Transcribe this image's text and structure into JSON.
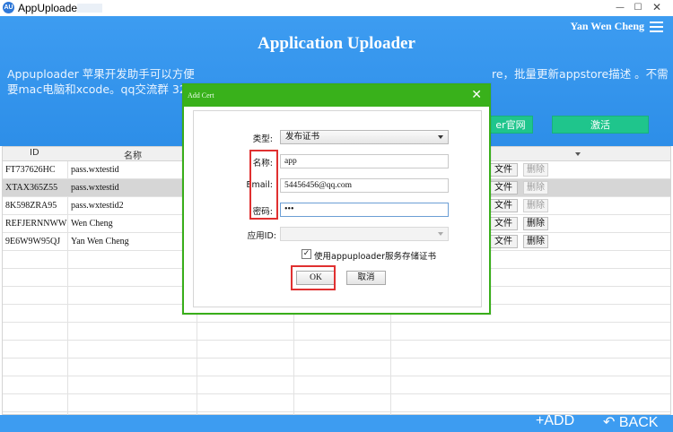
{
  "window": {
    "app_icon_text": "AU",
    "title": "AppUploader",
    "minimize_glyph": "—",
    "maximize_glyph": "☐",
    "close_glyph": "✕"
  },
  "header": {
    "user_name": "Yan Wen Cheng",
    "title": "Application Uploader",
    "desc_line1_a": "Appuploader 苹果开发助手可以方便",
    "desc_line1_b": "re，批量更新appstore描述 。不需",
    "desc_line2": "要mac电脑和xcode。qq交流群 326",
    "site_button": "er官网",
    "activate_button": "激活",
    "accent_color": "#3d9cf1",
    "button_color": "#1fc58c"
  },
  "table": {
    "columns": [
      "ID",
      "名称"
    ],
    "rows": [
      {
        "id": "FT737626HC",
        "name": "pass.wxtestid",
        "file": "文件",
        "delete": "删除",
        "delete_enabled": false,
        "selected": false
      },
      {
        "id": "XTAX365Z55",
        "name": "pass.wxtestid",
        "file": "文件",
        "delete": "删除",
        "delete_enabled": false,
        "selected": true
      },
      {
        "id": "8K598ZRA95",
        "name": "pass.wxtestid2",
        "file": "文件",
        "delete": "删除",
        "delete_enabled": false,
        "selected": false
      },
      {
        "id": "REFJERNNWW",
        "name": "Wen Cheng",
        "file": "文件",
        "delete": "删除",
        "delete_enabled": true,
        "selected": false
      },
      {
        "id": "9E6W9W95QJ",
        "name": "Yan Wen Cheng",
        "file": "文件",
        "delete": "删除",
        "delete_enabled": true,
        "selected": false
      }
    ]
  },
  "bottom": {
    "add": "+ADD",
    "back": "↶ BACK"
  },
  "dialog": {
    "title": "Add Cert",
    "close_glyph": "✕",
    "type_label": "类型:",
    "type_value": "发布证书",
    "name_label": "名称:",
    "name_value": "app",
    "email_label": "Email:",
    "email_value": "54456456@qq.com",
    "password_label": "密码:",
    "password_value": "•••",
    "appid_label": "应用ID:",
    "appid_value": "",
    "checkbox_checked": true,
    "checkbox_label": "使用appuploader服务存储证书",
    "ok_button": "OK",
    "cancel_button": "取消",
    "highlight_color": "#e03030",
    "border_color": "#39b11b"
  }
}
